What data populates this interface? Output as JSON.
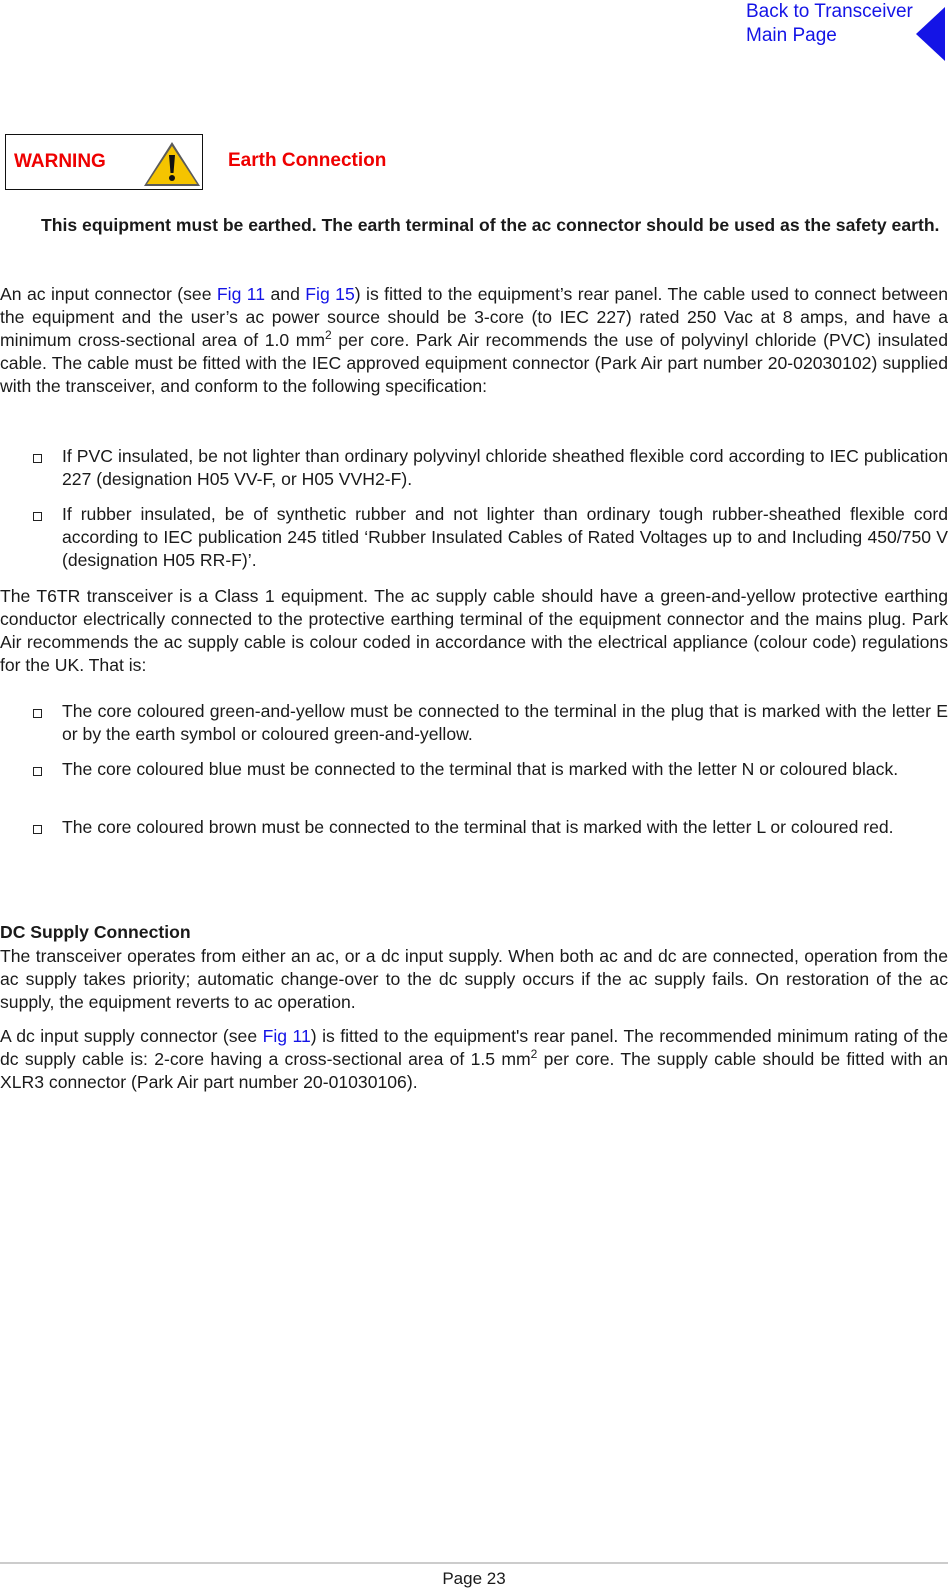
{
  "nav": {
    "back_line1": "Back to Transceiver",
    "back_line2": "Main Page",
    "back_icon": "left-triangle-arrow",
    "link_color": "#1414e6"
  },
  "warning": {
    "label": "WARNING",
    "icon": "warning-triangle-icon",
    "title": "Earth Connection",
    "color": "#ee0000",
    "text": "This equipment must be earthed. The earth terminal of the ac connector should be used as the safety earth."
  },
  "ac": {
    "p1_a": "An ac input connector (see ",
    "link1": "Fig 11",
    "p1_b": " and ",
    "link2": "Fig 15",
    "p1_c": ") is fitted to the equipment’s rear panel. The cable used to connect between the equipment and the user’s ac power source should be 3-core (to IEC 227) rated 250 Vac at 8 amps, and have a minimum cross-sectional area of 1.0 mm",
    "sup1": "2",
    "p1_d": " per core. Park Air recommends the use of polyvinyl chloride (PVC) insulated cable. The cable must be fitted with the IEC approved equipment connector (Park Air part number 20-02030102) supplied with the transceiver, and conform to the following specification:",
    "spec_bullets": [
      "If PVC insulated, be not lighter than ordinary polyvinyl chloride sheathed flexible cord according to IEC publication 227 (designation H05 VV-F, or H05 VVH2-F).",
      "If rubber insulated, be of synthetic rubber and not lighter than ordinary tough rubber-sheathed flexible cord according to IEC publication 245 titled ‘Rubber Insulated Cables of Rated Voltages up to and Including 450/750 V (designation H05 RR-F)’."
    ],
    "p2": "The T6TR transceiver is a Class 1 equipment. The ac supply cable should have a green-and-yellow protective earthing conductor electrically connected to the protective earthing terminal of the equipment connector and the mains plug. Park Air recommends the ac supply cable is colour coded in accordance with the electrical appliance (colour code) regulations for the UK. That is:",
    "colour_bullets": [
      "The core coloured green-and-yellow must be connected to the terminal in the plug that is marked with the letter E or by the earth symbol or coloured green-and-yellow.",
      "The core coloured blue must be connected to the terminal that is marked with the letter N or coloured black.",
      "The core coloured brown must be connected to the terminal that is marked with the letter L or coloured red."
    ]
  },
  "dc": {
    "heading": "DC Supply Connection",
    "p1": "The transceiver operates from either an ac, or a dc input supply. When both ac and dc are connected, operation from the ac supply takes priority; automatic change-over to the dc supply occurs if the ac supply fails. On restoration of the ac supply, the equipment reverts to ac operation.",
    "p2_a": "A dc input supply connector (see ",
    "link1": "Fig 11",
    "p2_b": ") is fitted to the equipment's rear panel. The recommended minimum rating of the dc supply cable is: 2-core having a cross-sectional area of 1.5 mm",
    "sup1": "2",
    "p2_c": " per core. The supply cable should be fitted with an XLR3 connector (Park Air part number 20-01030106)."
  },
  "footer": {
    "page": "Page 23"
  }
}
